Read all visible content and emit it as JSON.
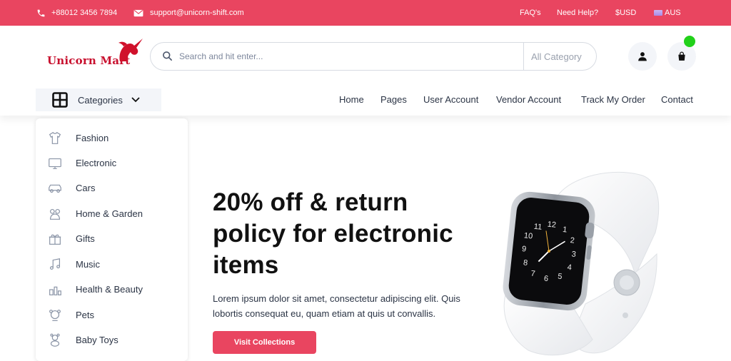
{
  "topbar": {
    "phone": "+88012 3456 7894",
    "email": "support@unicorn-shift.com",
    "faq": "FAQ's",
    "help": "Need Help?",
    "currency": "$USD",
    "language": "AUS"
  },
  "header": {
    "logo_text": "Unicorn Mart",
    "search_placeholder": "Search and hit enter...",
    "category_select": "All Category"
  },
  "nav": {
    "categories_label": "Categories",
    "links": [
      "Home",
      "Pages",
      "User Account",
      "Vendor Account",
      "Track My Order",
      "Contact"
    ]
  },
  "sidebar": {
    "items": [
      {
        "label": "Fashion",
        "icon": "fashion-icon"
      },
      {
        "label": "Electronic",
        "icon": "electronic-icon"
      },
      {
        "label": "Cars",
        "icon": "car-icon"
      },
      {
        "label": "Home & Garden",
        "icon": "home-garden-icon"
      },
      {
        "label": "Gifts",
        "icon": "gift-icon"
      },
      {
        "label": "Music",
        "icon": "music-icon"
      },
      {
        "label": "Health & Beauty",
        "icon": "health-beauty-icon"
      },
      {
        "label": "Pets",
        "icon": "pet-icon"
      },
      {
        "label": "Baby Toys",
        "icon": "baby-toys-icon"
      }
    ]
  },
  "hero": {
    "title_line1": "20% off & return",
    "title_line2": "policy for electronic",
    "title_line3": "items",
    "description_line1": "Lorem ipsum dolor sit amet, consectetur adipiscing elit. Quis",
    "description_line2": "lobortis consequat eu, quam etiam at quis ut convallis.",
    "cta_label": "Visit Collections",
    "watch_numbers": [
      "12",
      "1",
      "2",
      "3",
      "4",
      "5",
      "6",
      "7",
      "8",
      "9",
      "10",
      "11"
    ]
  },
  "colors": {
    "accent": "#e94560",
    "cart_badge": "#22d11a",
    "text": "#2b3445"
  }
}
